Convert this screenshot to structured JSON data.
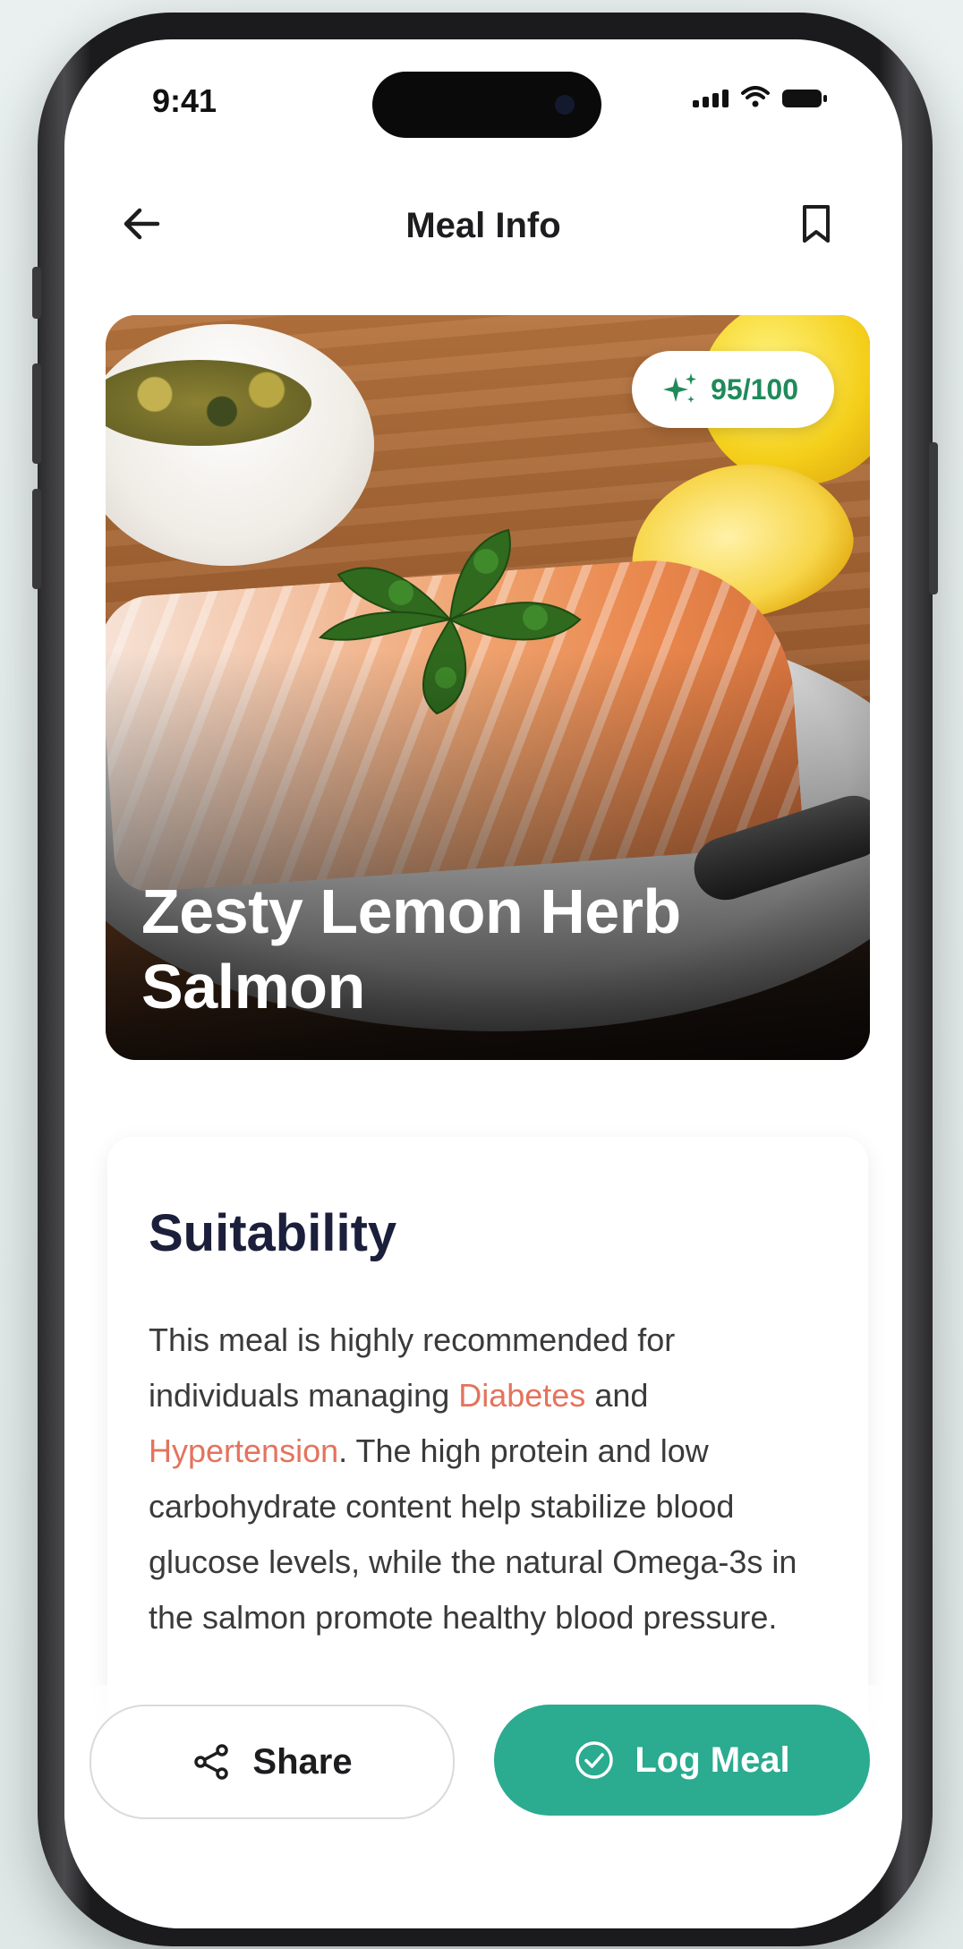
{
  "status_bar": {
    "time": "9:41"
  },
  "header": {
    "title": "Meal Info"
  },
  "meal": {
    "score": "95/100",
    "title_line1": "Zesty Lemon Herb",
    "title_line2": "Salmon"
  },
  "suitability": {
    "heading": "Suitability",
    "text_1": "This meal is highly recommended for individuals managing ",
    "condition_1": "Diabetes",
    "text_2": " and ",
    "condition_2": "Hypertension",
    "text_3": ". The high protein and low carbohydrate content help stabilize blood glucose levels, while the natural Omega-3s in the salmon promote healthy blood pressure."
  },
  "actions": {
    "share_label": "Share",
    "log_label": "Log Meal"
  },
  "colors": {
    "accent_green": "#2bab90",
    "score_green": "#1f8a5a",
    "highlight": "#e4735d",
    "heading": "#1b1f3b"
  },
  "icons": {
    "back": "arrow-left-icon",
    "bookmark": "bookmark-icon",
    "score": "sparkle-icon",
    "share": "share-icon",
    "log": "check-circle-icon"
  }
}
